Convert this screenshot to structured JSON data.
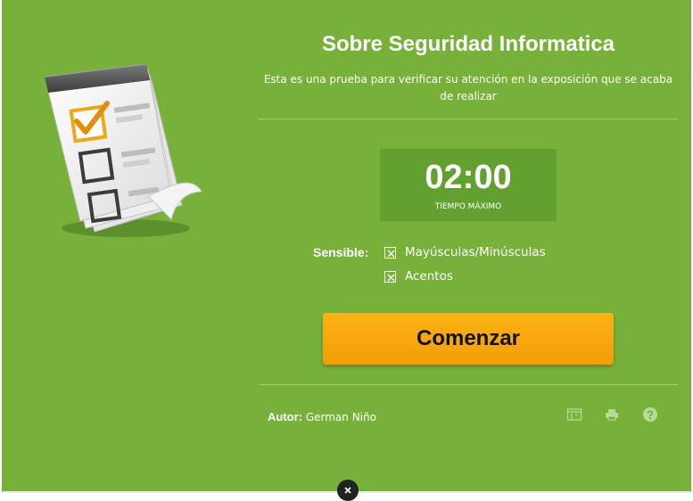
{
  "quiz": {
    "title": "Sobre Seguridad Informatica",
    "subtitle_line1": "Esta es una prueba para verificar su atención en la exposición que se acaba",
    "subtitle_line2": "de realizar"
  },
  "timer": {
    "value": "02:00",
    "label": "TIEMPO MÁXIMO"
  },
  "sensitivity": {
    "label": "Sensible:",
    "options": [
      {
        "label": "Mayúsculas/Minúsculas",
        "checked": true
      },
      {
        "label": "Acentos",
        "checked": true
      }
    ]
  },
  "start_button": {
    "label": "Comenzar"
  },
  "footer": {
    "author_label": "Autor:",
    "author_name": "German Niño",
    "icons": [
      "fullscreen-icon",
      "print-icon",
      "help-icon"
    ]
  },
  "colors": {
    "background": "#78b13a",
    "timer_box": "#62a02f",
    "button": "#f7a90d",
    "text": "#ffffff"
  }
}
